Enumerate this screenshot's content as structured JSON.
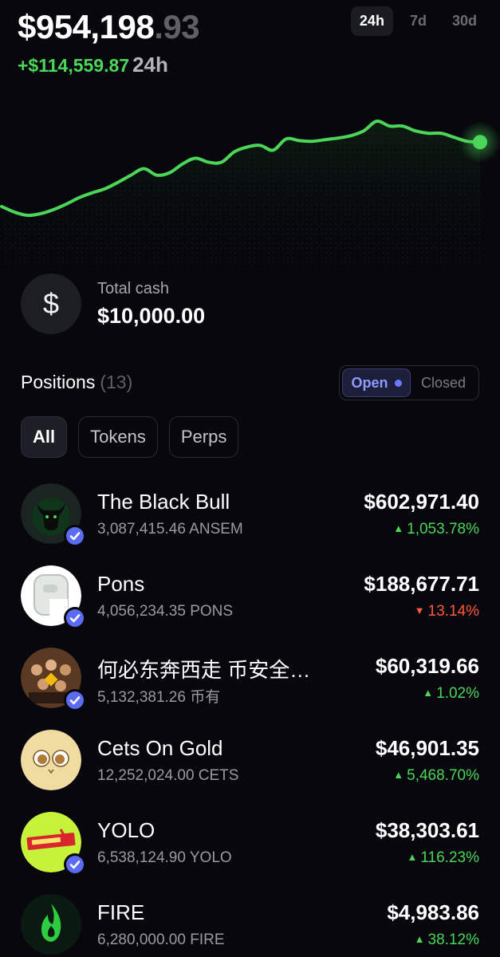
{
  "portfolio": {
    "balance_main": "$954,198",
    "balance_cents": ".93",
    "change_amount": "+$114,559.87",
    "change_period": "24h"
  },
  "range_tabs": [
    {
      "label": "24h",
      "active": true
    },
    {
      "label": "7d",
      "active": false
    },
    {
      "label": "30d",
      "active": false
    }
  ],
  "colors": {
    "accent_green": "#4bd65a",
    "accent_red": "#ff5a3c",
    "accent_blue": "#6b79ff",
    "background": "#07070d"
  },
  "chart_data": {
    "type": "line",
    "series": [
      {
        "values": [
          40,
          33,
          29,
          31,
          36,
          43,
          51,
          57,
          62,
          70,
          79,
          87,
          79,
          82,
          93,
          100,
          95,
          95,
          108,
          114,
          116,
          110,
          124,
          122,
          121,
          123,
          125,
          128,
          134,
          146,
          140,
          140,
          134,
          131,
          131,
          126,
          121,
          120
        ]
      }
    ],
    "grid": false
  },
  "cash": {
    "icon": "dollar-icon",
    "label": "Total cash",
    "value": "$10,000.00"
  },
  "positions": {
    "title": "Positions",
    "count": "(13)",
    "toggle": {
      "open_label": "Open",
      "closed_label": "Closed"
    },
    "filters": [
      {
        "label": "All",
        "active": true
      },
      {
        "label": "Tokens",
        "active": false
      },
      {
        "label": "Perps",
        "active": false
      }
    ],
    "items": [
      {
        "name": "The Black Bull",
        "holding": "3,087,415.46 ANSEM",
        "value": "$602,971.40",
        "change": "1,053.78%",
        "direction": "up",
        "verified": true,
        "icon": "bull-icon"
      },
      {
        "name": "Pons",
        "holding": "4,056,234.35 PONS",
        "value": "$188,677.71",
        "change": "13.14%",
        "direction": "down",
        "verified": true,
        "icon": "pons-p-icon"
      },
      {
        "name": "何必东奔西走 币安全…",
        "holding": "5,132,381.26 币有",
        "value": "$60,319.66",
        "change": "1.02%",
        "direction": "up",
        "verified": true,
        "icon": "group-photo-icon"
      },
      {
        "name": "Cets On Gold",
        "holding": "12,252,024.00 CETS",
        "value": "$46,901.35",
        "change": "5,468.70%",
        "direction": "up",
        "verified": false,
        "icon": "cat-face-icon"
      },
      {
        "name": "YOLO",
        "holding": "6,538,124.90 YOLO",
        "value": "$38,303.61",
        "change": "116.23%",
        "direction": "up",
        "verified": true,
        "icon": "yolo-logo-icon"
      },
      {
        "name": "FIRE",
        "holding": "6,280,000.00 FIRE",
        "value": "$4,983.86",
        "change": "38.12%",
        "direction": "up",
        "verified": false,
        "icon": "flame-icon"
      }
    ]
  }
}
